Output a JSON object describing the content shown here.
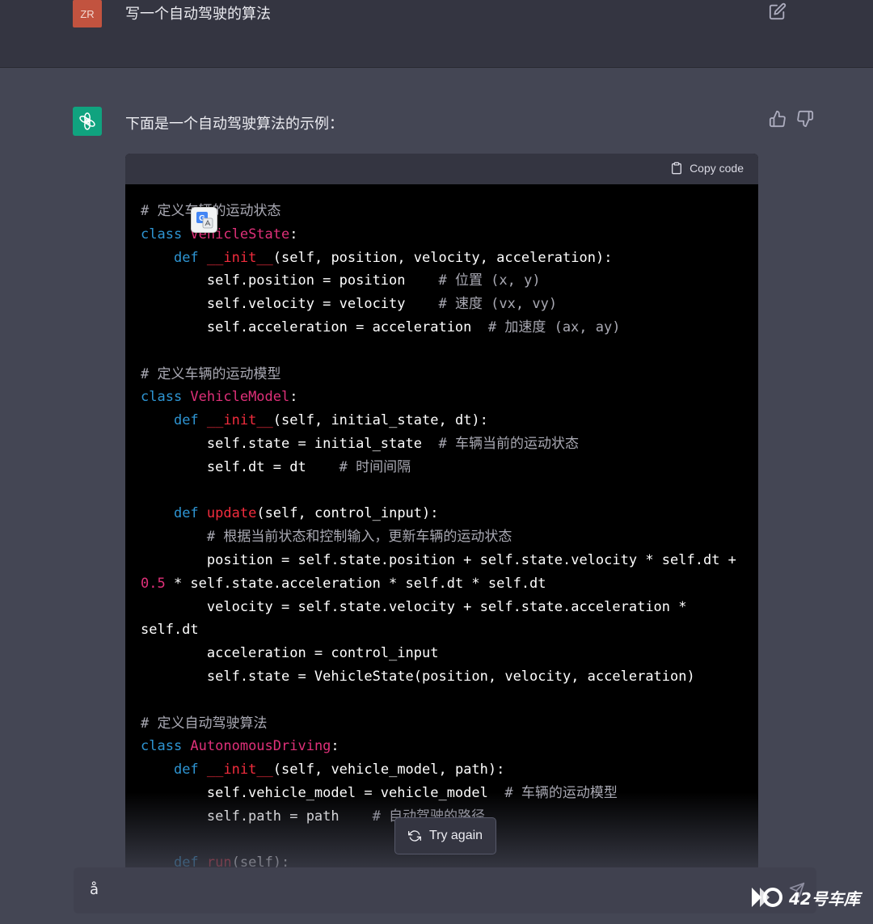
{
  "user_message": {
    "avatar_initials": "ZR",
    "text": "写一个自动驾驶的算法"
  },
  "assistant_message": {
    "intro": "下面是一个自动驾驶算法的示例："
  },
  "code_block": {
    "copy_label": "Copy code"
  },
  "code_lines": [
    [
      [
        "cm",
        "# 定义车辆的运动状态"
      ]
    ],
    [
      [
        "kw",
        "class "
      ],
      [
        "cls",
        "VehicleState"
      ],
      [
        "p",
        ":"
      ]
    ],
    [
      [
        "p",
        "    "
      ],
      [
        "kw",
        "def "
      ],
      [
        "fn",
        "__init__"
      ],
      [
        "p",
        "(self, position, velocity, acceleration):"
      ]
    ],
    [
      [
        "p",
        "        self.position = position    "
      ],
      [
        "cm",
        "# 位置 (x, y)"
      ]
    ],
    [
      [
        "p",
        "        self.velocity = velocity    "
      ],
      [
        "cm",
        "# 速度 (vx, vy)"
      ]
    ],
    [
      [
        "p",
        "        self.acceleration = acceleration  "
      ],
      [
        "cm",
        "# 加速度 (ax, ay)"
      ]
    ],
    [
      [
        "p",
        ""
      ]
    ],
    [
      [
        "cm",
        "# 定义车辆的运动模型"
      ]
    ],
    [
      [
        "kw",
        "class "
      ],
      [
        "cls",
        "VehicleModel"
      ],
      [
        "p",
        ":"
      ]
    ],
    [
      [
        "p",
        "    "
      ],
      [
        "kw",
        "def "
      ],
      [
        "fn",
        "__init__"
      ],
      [
        "p",
        "(self, initial_state, dt):"
      ]
    ],
    [
      [
        "p",
        "        self.state = initial_state  "
      ],
      [
        "cm",
        "# 车辆当前的运动状态"
      ]
    ],
    [
      [
        "p",
        "        self.dt = dt    "
      ],
      [
        "cm",
        "# 时间间隔"
      ]
    ],
    [
      [
        "p",
        ""
      ]
    ],
    [
      [
        "p",
        "    "
      ],
      [
        "kw",
        "def "
      ],
      [
        "fn",
        "update"
      ],
      [
        "p",
        "(self, control_input):"
      ]
    ],
    [
      [
        "p",
        "        "
      ],
      [
        "cm",
        "# 根据当前状态和控制输入，更新车辆的运动状态"
      ]
    ],
    [
      [
        "p",
        "        position = self.state.position + self.state.velocity * self.dt +"
      ]
    ],
    [
      [
        "num",
        "0.5"
      ],
      [
        "p",
        " * self.state.acceleration * self.dt * self.dt"
      ]
    ],
    [
      [
        "p",
        "        velocity = self.state.velocity + self.state.acceleration *"
      ]
    ],
    [
      [
        "p",
        "self.dt"
      ]
    ],
    [
      [
        "p",
        "        acceleration = control_input"
      ]
    ],
    [
      [
        "p",
        "        self.state = VehicleState(position, velocity, acceleration)"
      ]
    ],
    [
      [
        "p",
        ""
      ]
    ],
    [
      [
        "cm",
        "# 定义自动驾驶算法"
      ]
    ],
    [
      [
        "kw",
        "class "
      ],
      [
        "cls",
        "AutonomousDriving"
      ],
      [
        "p",
        ":"
      ]
    ],
    [
      [
        "p",
        "    "
      ],
      [
        "kw",
        "def "
      ],
      [
        "fn",
        "__init__"
      ],
      [
        "p",
        "(self, vehicle_model, path):"
      ]
    ],
    [
      [
        "p",
        "        self.vehicle_model = vehicle_model  "
      ],
      [
        "cm",
        "# 车辆的运动模型"
      ]
    ],
    [
      [
        "p",
        "        self.path = path    "
      ],
      [
        "cm",
        "# 自动驾驶的路径"
      ]
    ],
    [
      [
        "p",
        ""
      ]
    ],
    [
      [
        "p",
        "    "
      ],
      [
        "kw",
        "def "
      ],
      [
        "fn",
        "run"
      ],
      [
        "p",
        "(self):"
      ]
    ]
  ],
  "try_again": {
    "label": "Try again"
  },
  "input": {
    "value": "å"
  },
  "watermark": {
    "text": "42号车库"
  },
  "icons": {
    "edit": "edit-icon",
    "thumbs_up": "thumbs-up-icon",
    "thumbs_down": "thumbs-down-icon",
    "clipboard": "clipboard-icon",
    "refresh": "refresh-icon",
    "send": "send-icon",
    "translate": "google-translate-icon",
    "chatgpt": "chatgpt-logo-icon"
  },
  "colors": {
    "keyword": "#2e95d3",
    "class_name": "#df3079",
    "function": "#f22c3d",
    "comment": "#a9a9b3",
    "bot_avatar": "#10a37f",
    "user_avatar": "#c2533f"
  }
}
